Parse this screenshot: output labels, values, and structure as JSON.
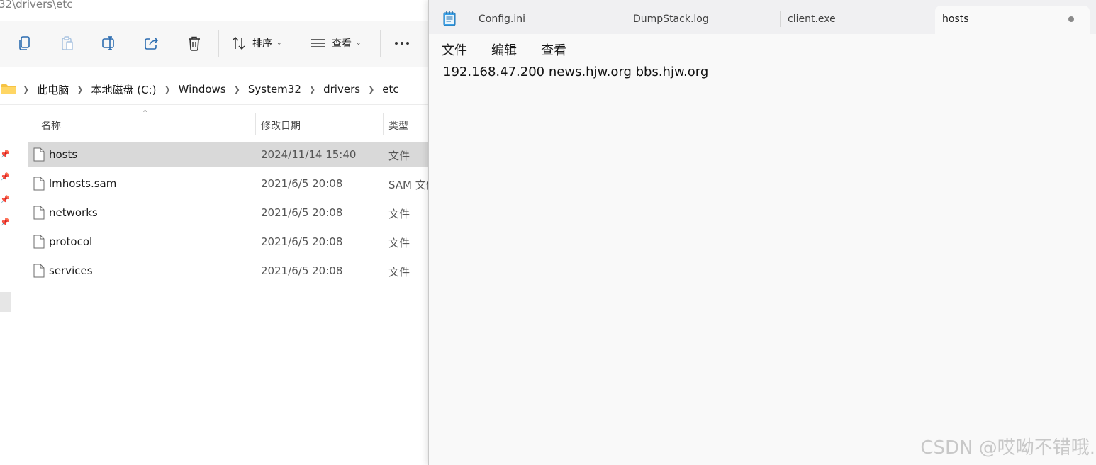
{
  "explorer": {
    "title_path": "32\\drivers\\etc",
    "toolbar": {
      "copy_icon": "copy-icon",
      "paste_icon": "paste-icon",
      "rename_icon": "rename-icon",
      "share_icon": "share-icon",
      "delete_icon": "delete-icon",
      "sort_label": "排序",
      "view_label": "查看",
      "more_icon": "more-icon"
    },
    "breadcrumbs": [
      "此电脑",
      "本地磁盘 (C:)",
      "Windows",
      "System32",
      "drivers",
      "etc"
    ],
    "columns": {
      "name": "名称",
      "modified": "修改日期",
      "type": "类型"
    },
    "files": [
      {
        "name": "hosts",
        "modified": "2024/11/14 15:40",
        "type": "文件",
        "selected": true
      },
      {
        "name": "lmhosts.sam",
        "modified": "2021/6/5 20:08",
        "type": "SAM 文件",
        "selected": false
      },
      {
        "name": "networks",
        "modified": "2021/6/5 20:08",
        "type": "文件",
        "selected": false
      },
      {
        "name": "protocol",
        "modified": "2021/6/5 20:08",
        "type": "文件",
        "selected": false
      },
      {
        "name": "services",
        "modified": "2021/6/5 20:08",
        "type": "文件",
        "selected": false
      }
    ]
  },
  "notepad": {
    "tabs": [
      {
        "label": "Config.ini"
      },
      {
        "label": "DumpStack.log"
      },
      {
        "label": "client.exe"
      },
      {
        "label": "hosts"
      }
    ],
    "menu": {
      "file": "文件",
      "edit": "编辑",
      "view": "查看"
    },
    "content": "192.168.47.200 news.hjw.org bbs.hjw.org"
  },
  "watermark": "CSDN @哎呦不错哦."
}
